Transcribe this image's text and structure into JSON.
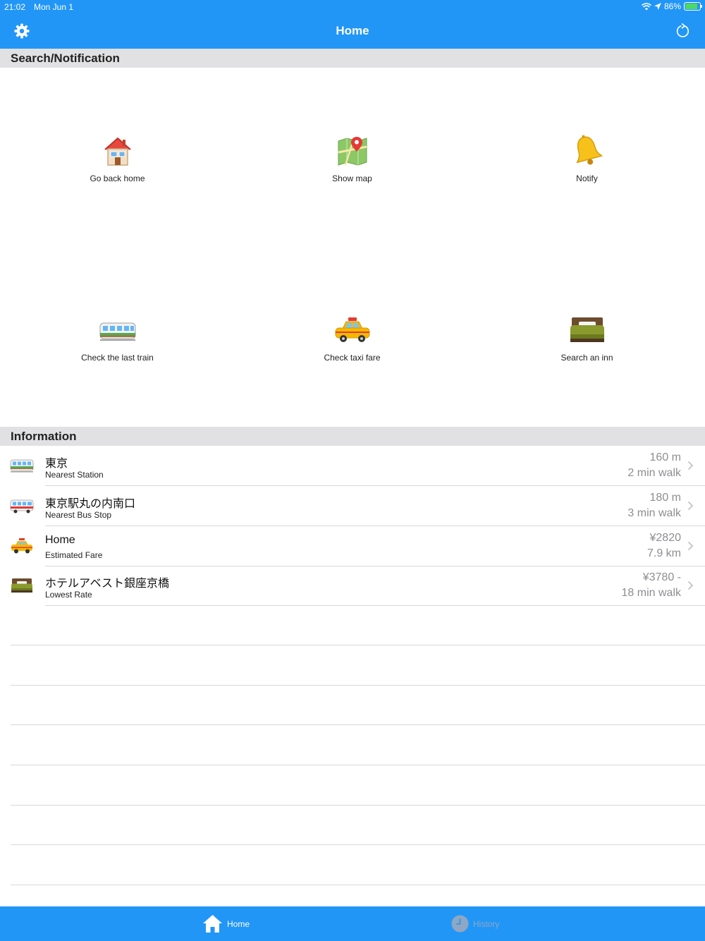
{
  "status": {
    "time": "21:02",
    "date": "Mon Jun 1",
    "battery": "86%",
    "battery_level": 0.86
  },
  "nav": {
    "title": "Home",
    "left_icon": "gear-icon",
    "right_icon": "refresh-icon"
  },
  "sections": {
    "search": "Search/Notification",
    "info": "Information"
  },
  "grid": [
    {
      "label": "Go back home",
      "icon": "house-icon"
    },
    {
      "label": "Show map",
      "icon": "map-icon"
    },
    {
      "label": "Notify",
      "icon": "bell-icon"
    },
    {
      "label": "Check the last train",
      "icon": "train-icon"
    },
    {
      "label": "Check taxi fare",
      "icon": "taxi-icon"
    },
    {
      "label": "Search an inn",
      "icon": "bed-icon"
    }
  ],
  "info_rows": [
    {
      "icon": "train-icon",
      "title": "東京",
      "subtitle": "Nearest Station",
      "value1": "160 m",
      "value2": "2 min walk"
    },
    {
      "icon": "bus-icon",
      "title": "東京駅丸の内南口",
      "subtitle": "Nearest Bus Stop",
      "value1": "180 m",
      "value2": "3 min walk"
    },
    {
      "icon": "taxi-icon",
      "title": "Home",
      "subtitle": "Estimated Fare",
      "value1": "¥2820",
      "value2": "7.9 km"
    },
    {
      "icon": "bed-icon",
      "title": "ホテルアベスト銀座京橋",
      "subtitle": "Lowest Rate",
      "value1": "¥3780 -",
      "value2": "18 min walk"
    }
  ],
  "tabs": [
    {
      "label": "Home",
      "icon": "house-icon",
      "selected": true
    },
    {
      "label": "History",
      "icon": "clock-icon",
      "selected": false
    }
  ],
  "colors": {
    "accent": "#2196f7",
    "section_bg": "#e1e1e3",
    "secondary_text": "#8e8e93"
  }
}
